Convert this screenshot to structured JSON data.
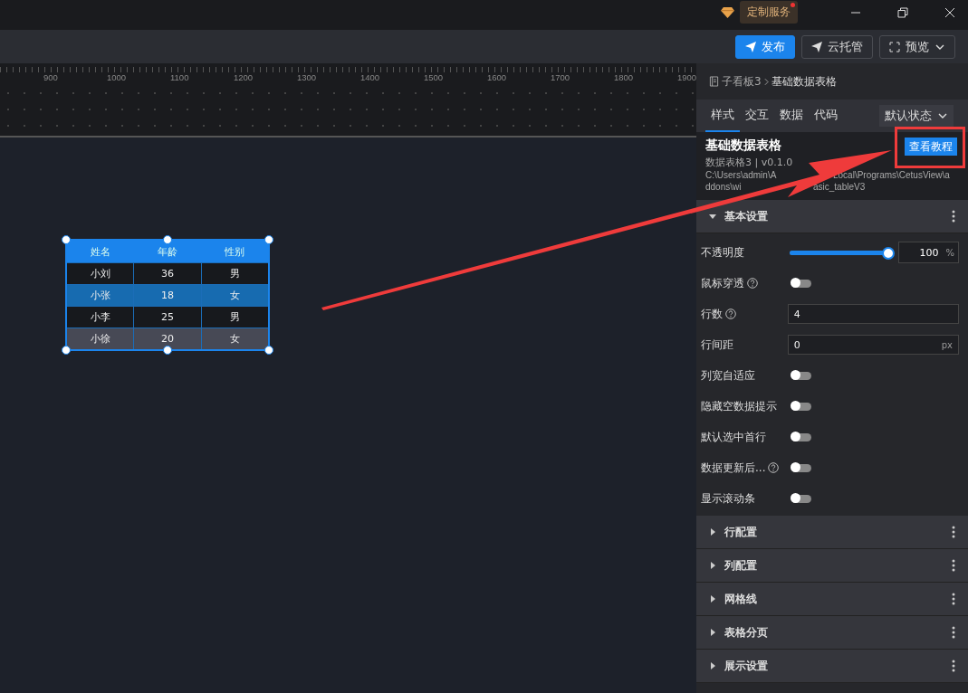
{
  "titlebar": {
    "service_button": "定制服务",
    "service_badge": true
  },
  "toolbar": {
    "buttons": [
      {
        "label": "发布",
        "kind": "primary"
      },
      {
        "label": "云托管",
        "kind": "plain"
      },
      {
        "label": "预览",
        "kind": "dropdown"
      }
    ]
  },
  "ruler": {
    "ticks": [
      "900",
      "1000",
      "1100",
      "1200",
      "1300",
      "1400",
      "1500",
      "1600",
      "1700",
      "1800",
      "1900"
    ]
  },
  "table_widget": {
    "columns": [
      "姓名",
      "年龄",
      "性别"
    ],
    "rows": [
      {
        "cells": [
          "小刘",
          "36",
          "男"
        ],
        "kind": "dark"
      },
      {
        "cells": [
          "小张",
          "18",
          "女"
        ],
        "kind": "highlight"
      },
      {
        "cells": [
          "小李",
          "25",
          "男"
        ],
        "kind": "dark"
      },
      {
        "cells": [
          "小徐",
          "20",
          "女"
        ],
        "kind": "grey"
      }
    ]
  },
  "panel": {
    "breadcrumb": [
      "子看板3",
      "基础数据表格"
    ],
    "tabs": [
      {
        "label": "样式",
        "selected": true
      },
      {
        "label": "交互",
        "selected": false
      },
      {
        "label": "数据",
        "selected": false
      },
      {
        "label": "代码",
        "selected": false
      }
    ],
    "state_select": "默认状态",
    "component_title": "基础数据表格",
    "component_meta": "数据表格3 | v0.1.0",
    "path_fragments": [
      [
        "C:\\Users\\admin\\A",
        "Local\\Programs\\CetusView\\a"
      ],
      [
        "ddons\\wi",
        "asic_tableV3"
      ]
    ],
    "tutorial_button": "查看教程",
    "sections": [
      {
        "title": "基本设置",
        "expanded": true,
        "settings": [
          {
            "kind": "slider",
            "label": "不透明度",
            "level": 1,
            "value": "100",
            "unit": "%"
          },
          {
            "kind": "switch",
            "label": "鼠标穿透",
            "help": true,
            "on": false
          },
          {
            "kind": "input",
            "label": "行数",
            "help": true,
            "value": "4"
          },
          {
            "kind": "input",
            "label": "行间距",
            "value": "0",
            "unit": "px"
          },
          {
            "kind": "switch",
            "label": "列宽自适应",
            "on": false
          },
          {
            "kind": "switch",
            "label": "隐藏空数据提示",
            "on": false
          },
          {
            "kind": "switch",
            "label": "默认选中首行",
            "on": false
          },
          {
            "kind": "switch",
            "label": "数据更新后...",
            "help": true,
            "on": false
          },
          {
            "kind": "switch",
            "label": "显示滚动条",
            "on": false
          }
        ]
      },
      {
        "title": "行配置",
        "expanded": false
      },
      {
        "title": "列配置",
        "expanded": false
      },
      {
        "title": "网格线",
        "expanded": false
      },
      {
        "title": "表格分页",
        "expanded": false
      },
      {
        "title": "展示设置",
        "expanded": false
      }
    ]
  },
  "annotation": {
    "arrow": true,
    "highlight_box": true
  }
}
